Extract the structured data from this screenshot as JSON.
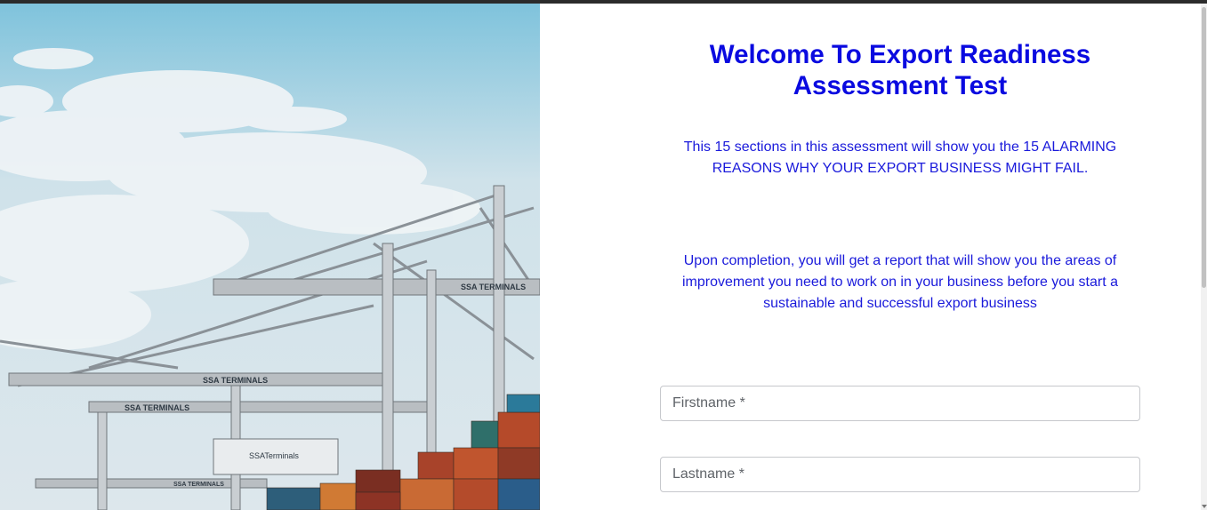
{
  "hero": {
    "crane_labels": [
      "SSA TERMINALS",
      "SSA TERMINALS",
      "SSA TERMINALS",
      "SSA TERMINALS"
    ],
    "ship_label": "SSATerminals"
  },
  "content": {
    "title": "Welcome To Export Readiness Assessment Test",
    "intro": "This 15 sections in this assessment will show you the 15 ALARMING REASONS WHY YOUR EXPORT BUSINESS MIGHT FAIL.",
    "completion": "Upon completion, you will get a report that will show you the areas of improvement you need to work on in your business before you start a sustainable and successful export business"
  },
  "form": {
    "firstname_placeholder": "Firstname *",
    "lastname_placeholder": "Lastname *"
  },
  "colors": {
    "heading": "#0a0ae0",
    "body_text": "#1a1adb",
    "sky": "#cfe3ea"
  }
}
